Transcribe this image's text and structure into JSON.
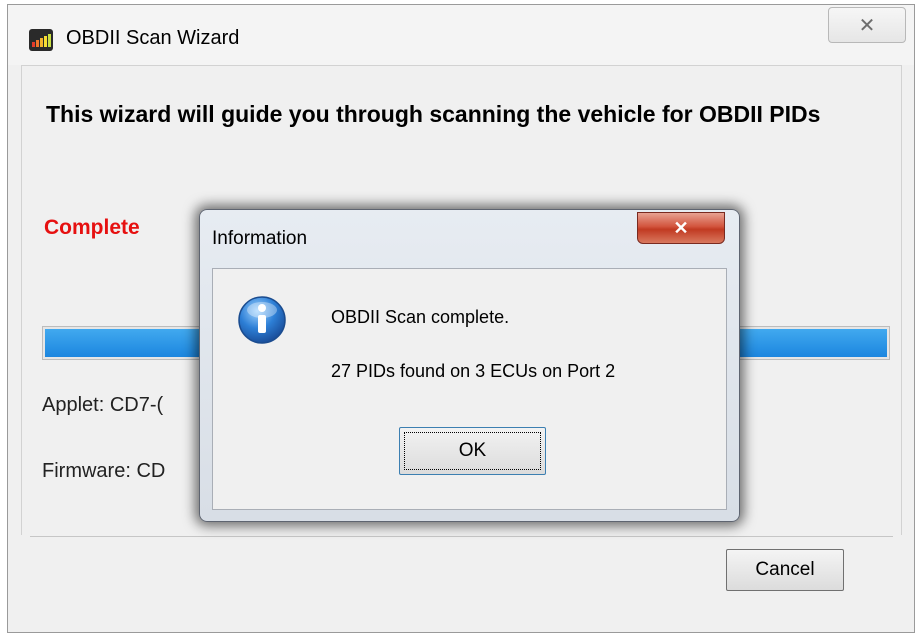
{
  "main_window": {
    "title": "OBDII Scan Wizard",
    "close_glyph": "✕",
    "headline": "This wizard will guide you through scanning the vehicle for OBDII PIDs",
    "status": "Complete",
    "progress_percent": 100,
    "applet_label": "Applet: CD7-(",
    "firmware_label": "Firmware: CD",
    "cancel_label": "Cancel",
    "status_color": "#e61010",
    "progress_color": "#2a8fe6"
  },
  "info_dialog": {
    "title": "Information",
    "close_glyph": "✕",
    "icon": "information-icon",
    "message_line1": "OBDII Scan complete.",
    "message_line2": "27 PIDs found on 3 ECUs on Port 2",
    "ok_label": "OK"
  }
}
